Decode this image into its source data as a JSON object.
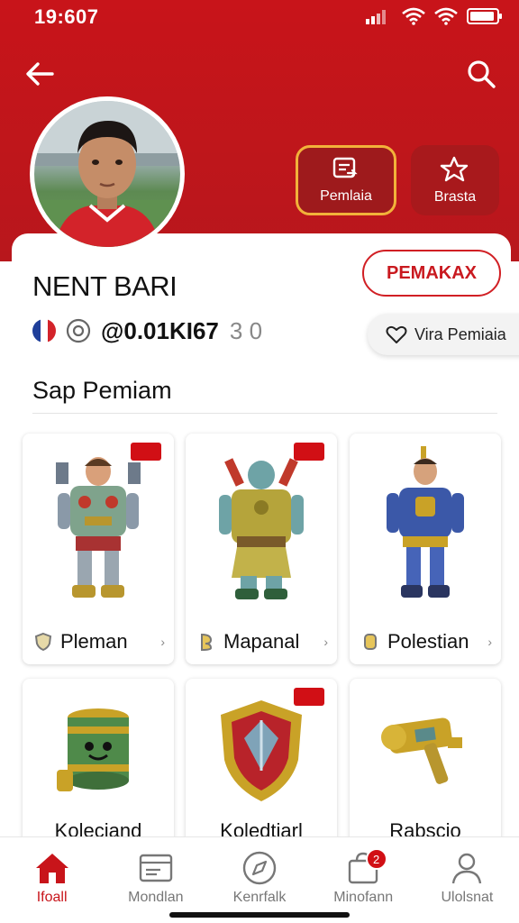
{
  "status_bar": {
    "time": "19:607"
  },
  "header": {
    "actions": [
      {
        "label": "Pemlaia",
        "icon": "inbox-icon"
      },
      {
        "label": "Brasta",
        "icon": "star-icon"
      }
    ]
  },
  "profile": {
    "name": "NENT BARI",
    "handle": "@0.01KI67",
    "handle_suffix": "3 0",
    "follow_label": "PEMAKAX",
    "wishlist_label": "Vira Pemiaia"
  },
  "section": {
    "title": "Sap Pemiam"
  },
  "items": [
    {
      "label": "Pleman",
      "badge": true,
      "icon": "robot-warrior-icon"
    },
    {
      "label": "Mapanal",
      "badge": true,
      "icon": "green-giant-icon"
    },
    {
      "label": "Polestian",
      "badge": false,
      "icon": "blue-knight-icon"
    },
    {
      "label": "Koleciand",
      "badge": false,
      "icon": "barrel-icon"
    },
    {
      "label": "Koledtiarl",
      "badge": true,
      "icon": "shield-icon"
    },
    {
      "label": "Rabscio",
      "badge": false,
      "icon": "gold-key-icon"
    }
  ],
  "nav": [
    {
      "label": "Ifoall",
      "icon": "home-icon",
      "active": true
    },
    {
      "label": "Mondlan",
      "icon": "card-icon",
      "active": false
    },
    {
      "label": "Kenrfalk",
      "icon": "compass-icon",
      "active": false
    },
    {
      "label": "Minofann",
      "icon": "bag-icon",
      "active": false,
      "badge": "2"
    },
    {
      "label": "Ulolsnat",
      "icon": "user-icon",
      "active": false
    }
  ],
  "colors": {
    "brand_red": "#c8141a",
    "accent_gold": "#f2b23a"
  }
}
